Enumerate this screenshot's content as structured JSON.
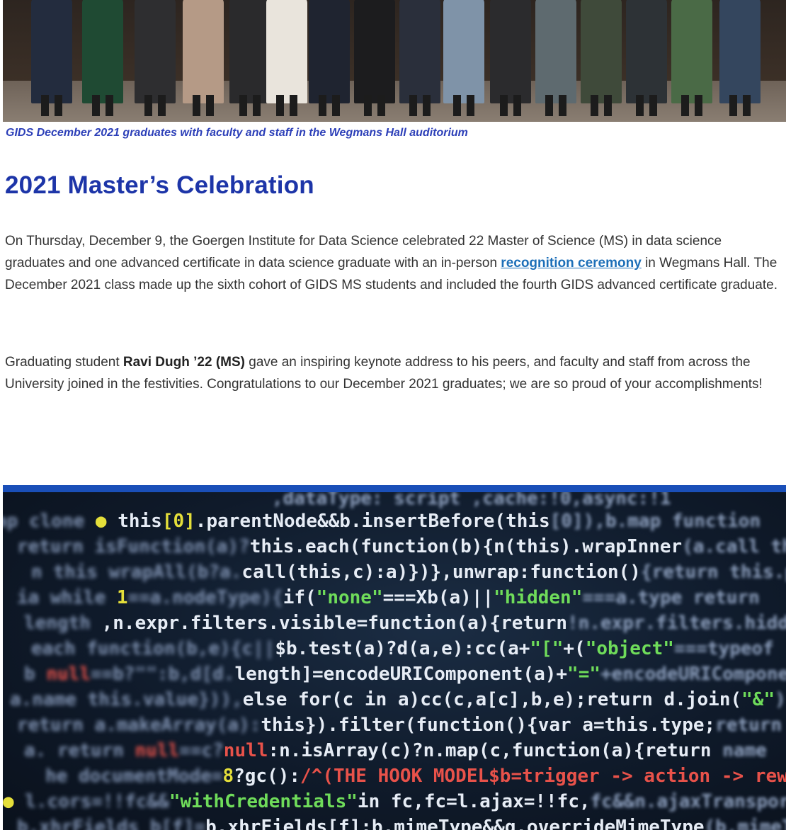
{
  "caption": "GIDS December 2021 graduates with faculty and staff in the Wegmans Hall auditorium",
  "heading": "2021 Master’s Celebration",
  "paragraph1": {
    "before_link": "On Thursday, December 9, the Goergen Institute for Data Science celebrated 22 Master of Science (MS) in data science graduates and one advanced certificate in data science graduate with an in-person ",
    "link_text": "recognition ceremony",
    "after_link": " in Wegmans Hall. The December 2021 class made up the sixth cohort of GIDS MS students and included the fourth GIDS advanced certificate graduate."
  },
  "paragraph2": {
    "before_bold": "Graduating student ",
    "bold_text": "Ravi Dugh ’22 (MS)",
    "after_bold": " gave an inspiring keynote address to his peers, and faculty and staff from across the University joined in the festivities. Congratulations to our December 2021 graduates; we are so proud of your accomplishments!"
  },
  "colors": {
    "caption": "#2c3fb8",
    "heading": "#1d35a8",
    "link": "#1d6fb8",
    "band": "#1a4fb8"
  }
}
